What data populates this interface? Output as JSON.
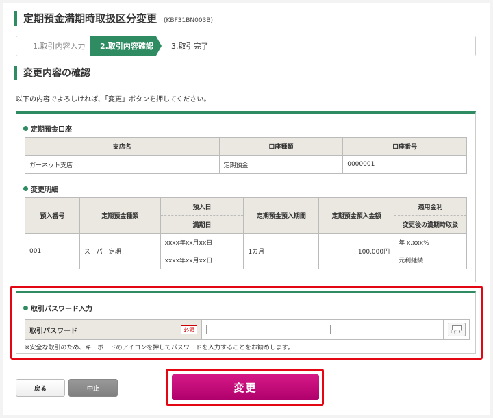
{
  "page": {
    "title": "定期預金満期時取扱区分変更",
    "screen_code": "(KBF31BN003B)"
  },
  "steps": [
    {
      "label": "1.取引内容入力"
    },
    {
      "label": "2.取引内容確認"
    },
    {
      "label": "3.取引完了"
    }
  ],
  "section": {
    "title": "変更内容の確認",
    "lead": "以下の内容でよろしければ、「変更」ボタンを押してください。"
  },
  "account": {
    "heading": "定期預金口座",
    "headers": [
      "支店名",
      "口座種類",
      "口座番号"
    ],
    "row": [
      "ガーネット支店",
      "定期預金",
      "0000001"
    ]
  },
  "details": {
    "heading": "変更明細",
    "headers": {
      "deposit_no": "預入番号",
      "deposit_type": "定期預金種類",
      "deposit_date": "預入日",
      "maturity_date": "満期日",
      "period": "定期預金預入期間",
      "amount": "定期預金預入金額",
      "rate": "適用金利",
      "handling": "変更後の満期時取扱"
    },
    "row": {
      "deposit_no": "001",
      "deposit_type": "スーパー定期",
      "deposit_date": "xxxx年xx月xx日",
      "maturity_date": "xxxx年xx月xx日",
      "period": "1カ月",
      "amount": "100,000円",
      "rate": "年 x.xxx%",
      "handling": "元利継続"
    }
  },
  "password": {
    "heading": "取引パスワード入力",
    "label": "取引パスワード",
    "required": "必須",
    "value": "",
    "keyboard_label": "ｷｰﾎﾞｰﾄﾞ",
    "note": "※安全な取引のため、キーボードのアイコンを押してパスワードを入力することをお勧めします。"
  },
  "buttons": {
    "back": "戻る",
    "cancel": "中止",
    "submit": "変更"
  },
  "colors": {
    "brand_green": "#2e8b62",
    "submit_magenta": "#c80f7c",
    "highlight_red": "#e30613"
  }
}
